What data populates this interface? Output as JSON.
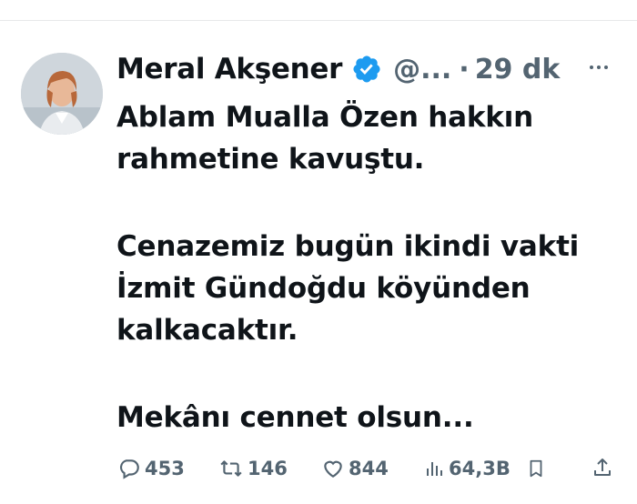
{
  "tweet": {
    "author_name": "Meral Akşener",
    "handle": "@...",
    "separator": "·",
    "time": "29 dk",
    "lines": [
      "Ablam Mualla Özen hakkın",
      "rahmetine kavuştu.",
      "Cenazemiz bugün ikindi vakti",
      "İzmit Gündoğdu köyünden",
      "kalkacaktır.",
      "Mekânı cennet olsun..."
    ]
  },
  "actions": {
    "replies": "453",
    "retweets": "146",
    "likes": "844",
    "views": "64,3B"
  },
  "colors": {
    "text": "#0f1419",
    "muted": "#536471",
    "verified": "#1d9bf0"
  },
  "icons": [
    "verified-badge-icon",
    "more-icon",
    "reply-icon",
    "retweet-icon",
    "like-icon",
    "views-icon",
    "bookmark-icon",
    "share-icon"
  ]
}
